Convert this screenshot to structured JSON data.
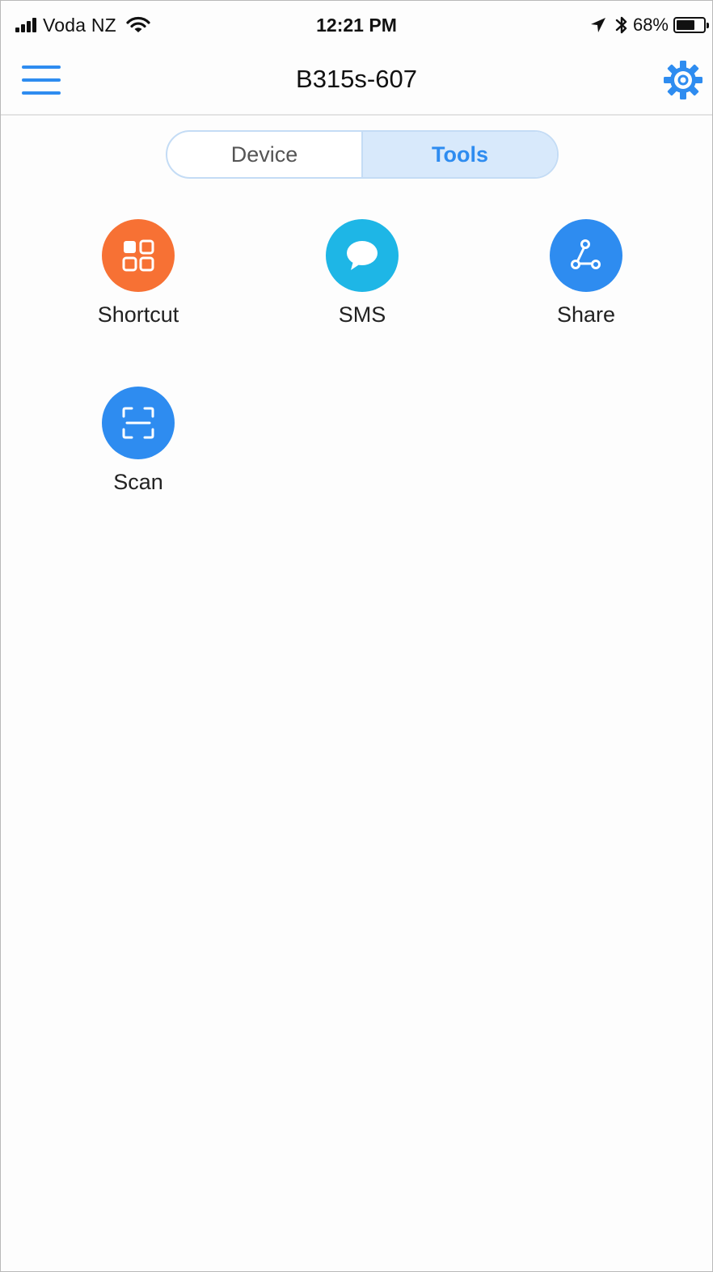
{
  "status_bar": {
    "carrier": "Voda NZ",
    "time": "12:21 PM",
    "battery_percent": "68%",
    "battery_level": 0.68,
    "icons": [
      "signal-icon",
      "wifi-icon",
      "location-arrow-icon",
      "bluetooth-icon",
      "battery-icon"
    ]
  },
  "nav": {
    "title": "B315s-607",
    "left_icon": "hamburger-menu-icon",
    "right_icon": "gear-icon",
    "accent_color": "#2e8cf0"
  },
  "tabs": [
    {
      "label": "Device",
      "active": false
    },
    {
      "label": "Tools",
      "active": true
    }
  ],
  "tools": [
    {
      "label": "Shortcut",
      "icon": "grid-shortcut-icon",
      "color": "#f77134"
    },
    {
      "label": "SMS",
      "icon": "chat-bubble-icon",
      "color": "#1eb6e6"
    },
    {
      "label": "Share",
      "icon": "share-nodes-icon",
      "color": "#2e8cf0"
    },
    {
      "label": "Scan",
      "icon": "scan-frame-icon",
      "color": "#2e8cf0"
    }
  ]
}
